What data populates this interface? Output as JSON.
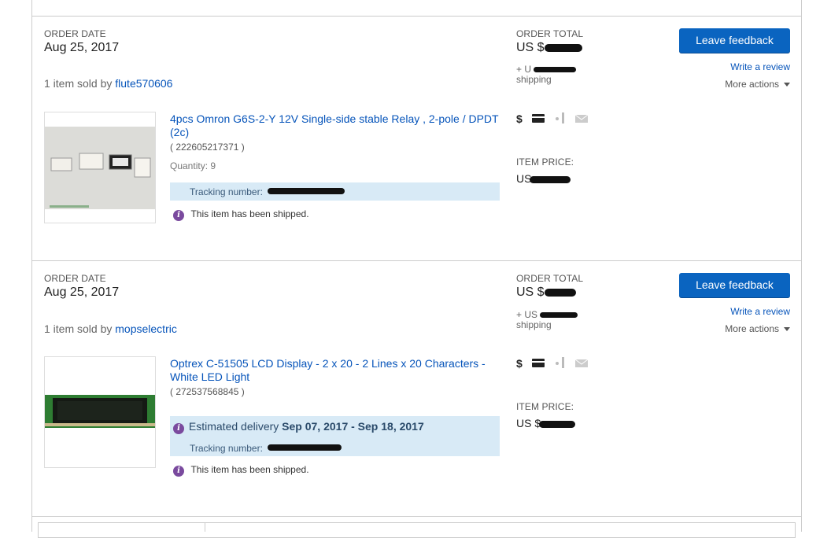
{
  "orders": [
    {
      "order_date_label": "ORDER DATE",
      "order_date": "Aug 25, 2017",
      "sold_by_prefix": "1 item sold by ",
      "seller": "flute570606",
      "item_title": "4pcs Omron G6S-2-Y 12V Single-side stable Relay , 2-pole / DPDT (2c)",
      "item_id": "( 222605217371 )",
      "quantity": "Quantity: 9",
      "tracking_label": "Tracking number:",
      "shipped_text": "This item has been shipped.",
      "order_total_label": "ORDER TOTAL",
      "order_total": "US $",
      "shipping_prefix": "+ U",
      "shipping_label": "shipping",
      "item_price_label": "ITEM PRICE:",
      "item_price": "US",
      "leave_feedback": "Leave feedback",
      "write_review": "Write a review",
      "more_actions": "More actions"
    },
    {
      "order_date_label": "ORDER DATE",
      "order_date": "Aug 25, 2017",
      "sold_by_prefix": "1 item sold by ",
      "seller": "mopselectric",
      "item_title": "Optrex C-51505 LCD Display - 2 x 20 - 2 Lines x 20 Characters - White LED Light",
      "item_id": "( 272537568845 )",
      "estimated_label": "Estimated delivery ",
      "estimated_dates": "Sep 07, 2017 - Sep 18, 2017",
      "tracking_label": "Tracking number:",
      "shipped_text": "This item has been shipped.",
      "order_total_label": "ORDER TOTAL",
      "order_total": "US $",
      "shipping_prefix": "+ US",
      "shipping_label": "shipping",
      "item_price_label": "ITEM PRICE:",
      "item_price": "US $",
      "leave_feedback": "Leave feedback",
      "write_review": "Write a review",
      "more_actions": "More actions"
    }
  ],
  "status_icons": [
    "dollar-icon",
    "payment-card-icon",
    "shipping-truck-icon",
    "envelope-icon"
  ],
  "colors": {
    "link": "#0654ba",
    "button": "#0a64c0",
    "tracking_bg": "#d8eaf6",
    "info_icon": "#7a4a9e"
  }
}
